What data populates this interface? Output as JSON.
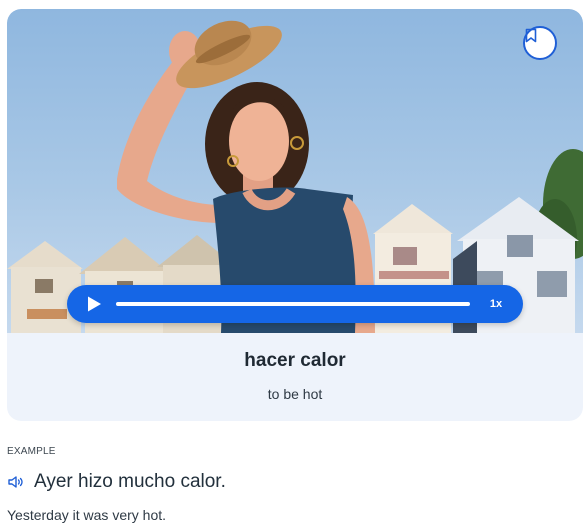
{
  "flashcard": {
    "image_alt": "Woman holding a straw hat in front of painted houses",
    "word": "hacer calor",
    "translation": "to be hot",
    "bookmark_icon": "bookmark-icon"
  },
  "audio_player": {
    "play_icon": "play-icon",
    "speed": "1x",
    "progress": 0
  },
  "example": {
    "label": "EXAMPLE",
    "speaker_icon": "speaker-icon",
    "sentence": "Ayer hizo mucho calor.",
    "translation": "Yesterday it was very hot."
  },
  "colors": {
    "accent": "#1566e6",
    "card_background": "#eef3fb"
  }
}
